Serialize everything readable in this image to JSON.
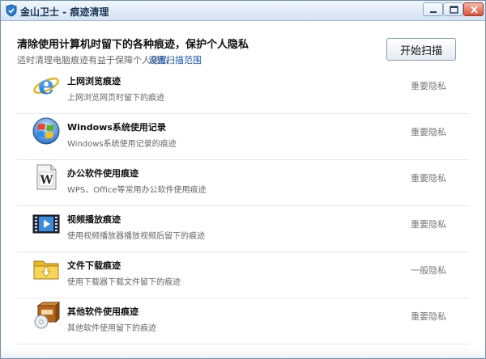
{
  "window": {
    "title": "金山卫士 - 痕迹清理",
    "app_icon": "shield-icon",
    "controls": {
      "minimize": "minimize-icon",
      "maximize": "maximize-icon",
      "close": "close-icon"
    }
  },
  "header": {
    "title": "清除使用计算机时留下的各种痕迹，保护个人隐私",
    "subtitle": "适时清理电脑痕迹有益于保障个人隐私",
    "settings_link": "设置扫描范围",
    "scan_button": "开始扫描"
  },
  "colors": {
    "link": "#1256c8",
    "titlebar_top": "#f1f6fc",
    "titlebar_bottom": "#d3e2f3"
  },
  "items": [
    {
      "icon": "internet-explorer-icon",
      "title": "上网浏览痕迹",
      "desc": "上网浏览网页时留下的痕迹",
      "level": "重要隐私"
    },
    {
      "icon": "windows-logo-icon",
      "title": "Windows系统使用记录",
      "desc": "Windows系统使用记录的痕迹",
      "level": "重要隐私"
    },
    {
      "icon": "word-document-icon",
      "title": "办公软件使用痕迹",
      "desc": "WPS、Office等常用办公软件使用痕迹",
      "level": "重要隐私"
    },
    {
      "icon": "video-player-icon",
      "title": "视频播放痕迹",
      "desc": "使用视频播放器播放视频后留下的痕迹",
      "level": "重要隐私"
    },
    {
      "icon": "download-folder-icon",
      "title": "文件下载痕迹",
      "desc": "使用下载器下载文件留下的痕迹",
      "level": "一般隐私"
    },
    {
      "icon": "software-box-icon",
      "title": "其他软件使用痕迹",
      "desc": "其他软件使用留下的痕迹",
      "level": "重要隐私"
    }
  ]
}
